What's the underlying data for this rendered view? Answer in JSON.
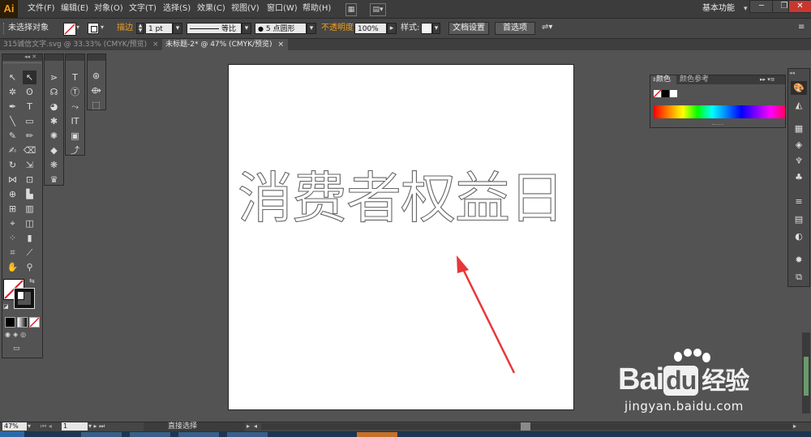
{
  "app": {
    "logo": "Ai"
  },
  "menu": [
    "文件(F)",
    "编辑(E)",
    "对象(O)",
    "文字(T)",
    "选择(S)",
    "效果(C)",
    "视图(V)",
    "窗口(W)",
    "帮助(H)"
  ],
  "workspace": "基本功能",
  "control": {
    "selection": "未选择对象",
    "stroke_label": "描边",
    "stroke_weight": "1 pt",
    "stroke_profile": "等比",
    "brush": "5 点圆形",
    "opacity_label": "不透明度",
    "opacity_value": "100%",
    "style_label": "样式:",
    "doc_setup": "文档设置",
    "preferences": "首选项"
  },
  "tabs": [
    {
      "label": "315诚信文字.svg @ 33.33% (CMYK/预览)",
      "close": "×",
      "active": false
    },
    {
      "label": "未标题-2* @ 47% (CMYK/预览)",
      "close": "×",
      "active": true
    }
  ],
  "artwork": {
    "text": "消费者权益日"
  },
  "color_panel": {
    "tab_color": "颜色",
    "tab_guide": "颜色参考"
  },
  "status": {
    "zoom": "47%",
    "page": "1",
    "tool": "直接选择"
  },
  "watermark": {
    "main": "Bai",
    "du": "du",
    "jingyan": "经验",
    "url": "jingyan.baidu.com"
  },
  "colors": {
    "accent_orange": "#f0a020",
    "arrow_red": "#e8363a",
    "none_red": "#e0202a"
  }
}
